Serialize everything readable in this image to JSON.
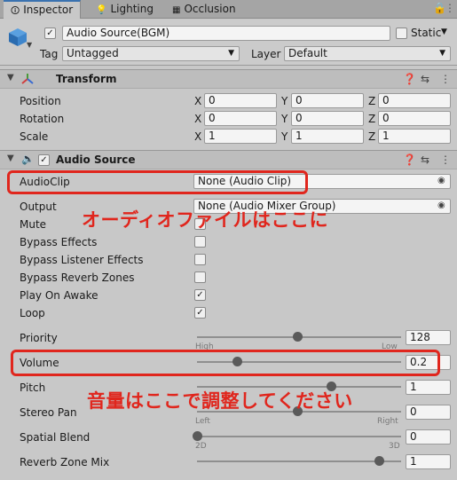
{
  "tabs": [
    {
      "label": "Inspector",
      "icon": "info-icon"
    },
    {
      "label": "Lighting",
      "icon": "lightbulb-icon"
    },
    {
      "label": "Occlusion",
      "icon": "occlusion-icon"
    }
  ],
  "object": {
    "name": "Audio Source(BGM)",
    "static_label": "Static",
    "tag_label": "Tag",
    "tag_value": "Untagged",
    "layer_label": "Layer",
    "layer_value": "Default"
  },
  "transform": {
    "title": "Transform",
    "rows": [
      {
        "label": "Position",
        "x": "0",
        "y": "0",
        "z": "0"
      },
      {
        "label": "Rotation",
        "x": "0",
        "y": "0",
        "z": "0"
      },
      {
        "label": "Scale",
        "x": "1",
        "y": "1",
        "z": "1"
      }
    ]
  },
  "audio_source": {
    "title": "Audio Source",
    "audioclip_label": "AudioClip",
    "audioclip_value": "None (Audio Clip)",
    "output_label": "Output",
    "output_value": "None (Audio Mixer Group)",
    "toggles": [
      {
        "label": "Mute",
        "checked": false
      },
      {
        "label": "Bypass Effects",
        "checked": false
      },
      {
        "label": "Bypass Listener Effects",
        "checked": false
      },
      {
        "label": "Bypass Reverb Zones",
        "checked": false
      },
      {
        "label": "Play On Awake",
        "checked": true
      },
      {
        "label": "Loop",
        "checked": true
      }
    ],
    "priority_label": "Priority",
    "priority_value": "128",
    "priority_min_label": "High",
    "priority_max_label": "Low",
    "volume_label": "Volume",
    "volume_value": "0.2",
    "pitch_label": "Pitch",
    "pitch_value": "1",
    "stereo_label": "Stereo Pan",
    "stereo_value": "0",
    "stereo_min_label": "Left",
    "stereo_max_label": "Right",
    "spatial_label": "Spatial Blend",
    "spatial_value": "0",
    "spatial_min_label": "2D",
    "spatial_max_label": "3D",
    "reverb_label": "Reverb Zone Mix",
    "reverb_value": "1"
  },
  "annotations": {
    "audiofile": "オーディオファイルはここに",
    "volume": "音量はここで調整してください"
  },
  "colors": {
    "annotation_red": "#e0261d"
  }
}
